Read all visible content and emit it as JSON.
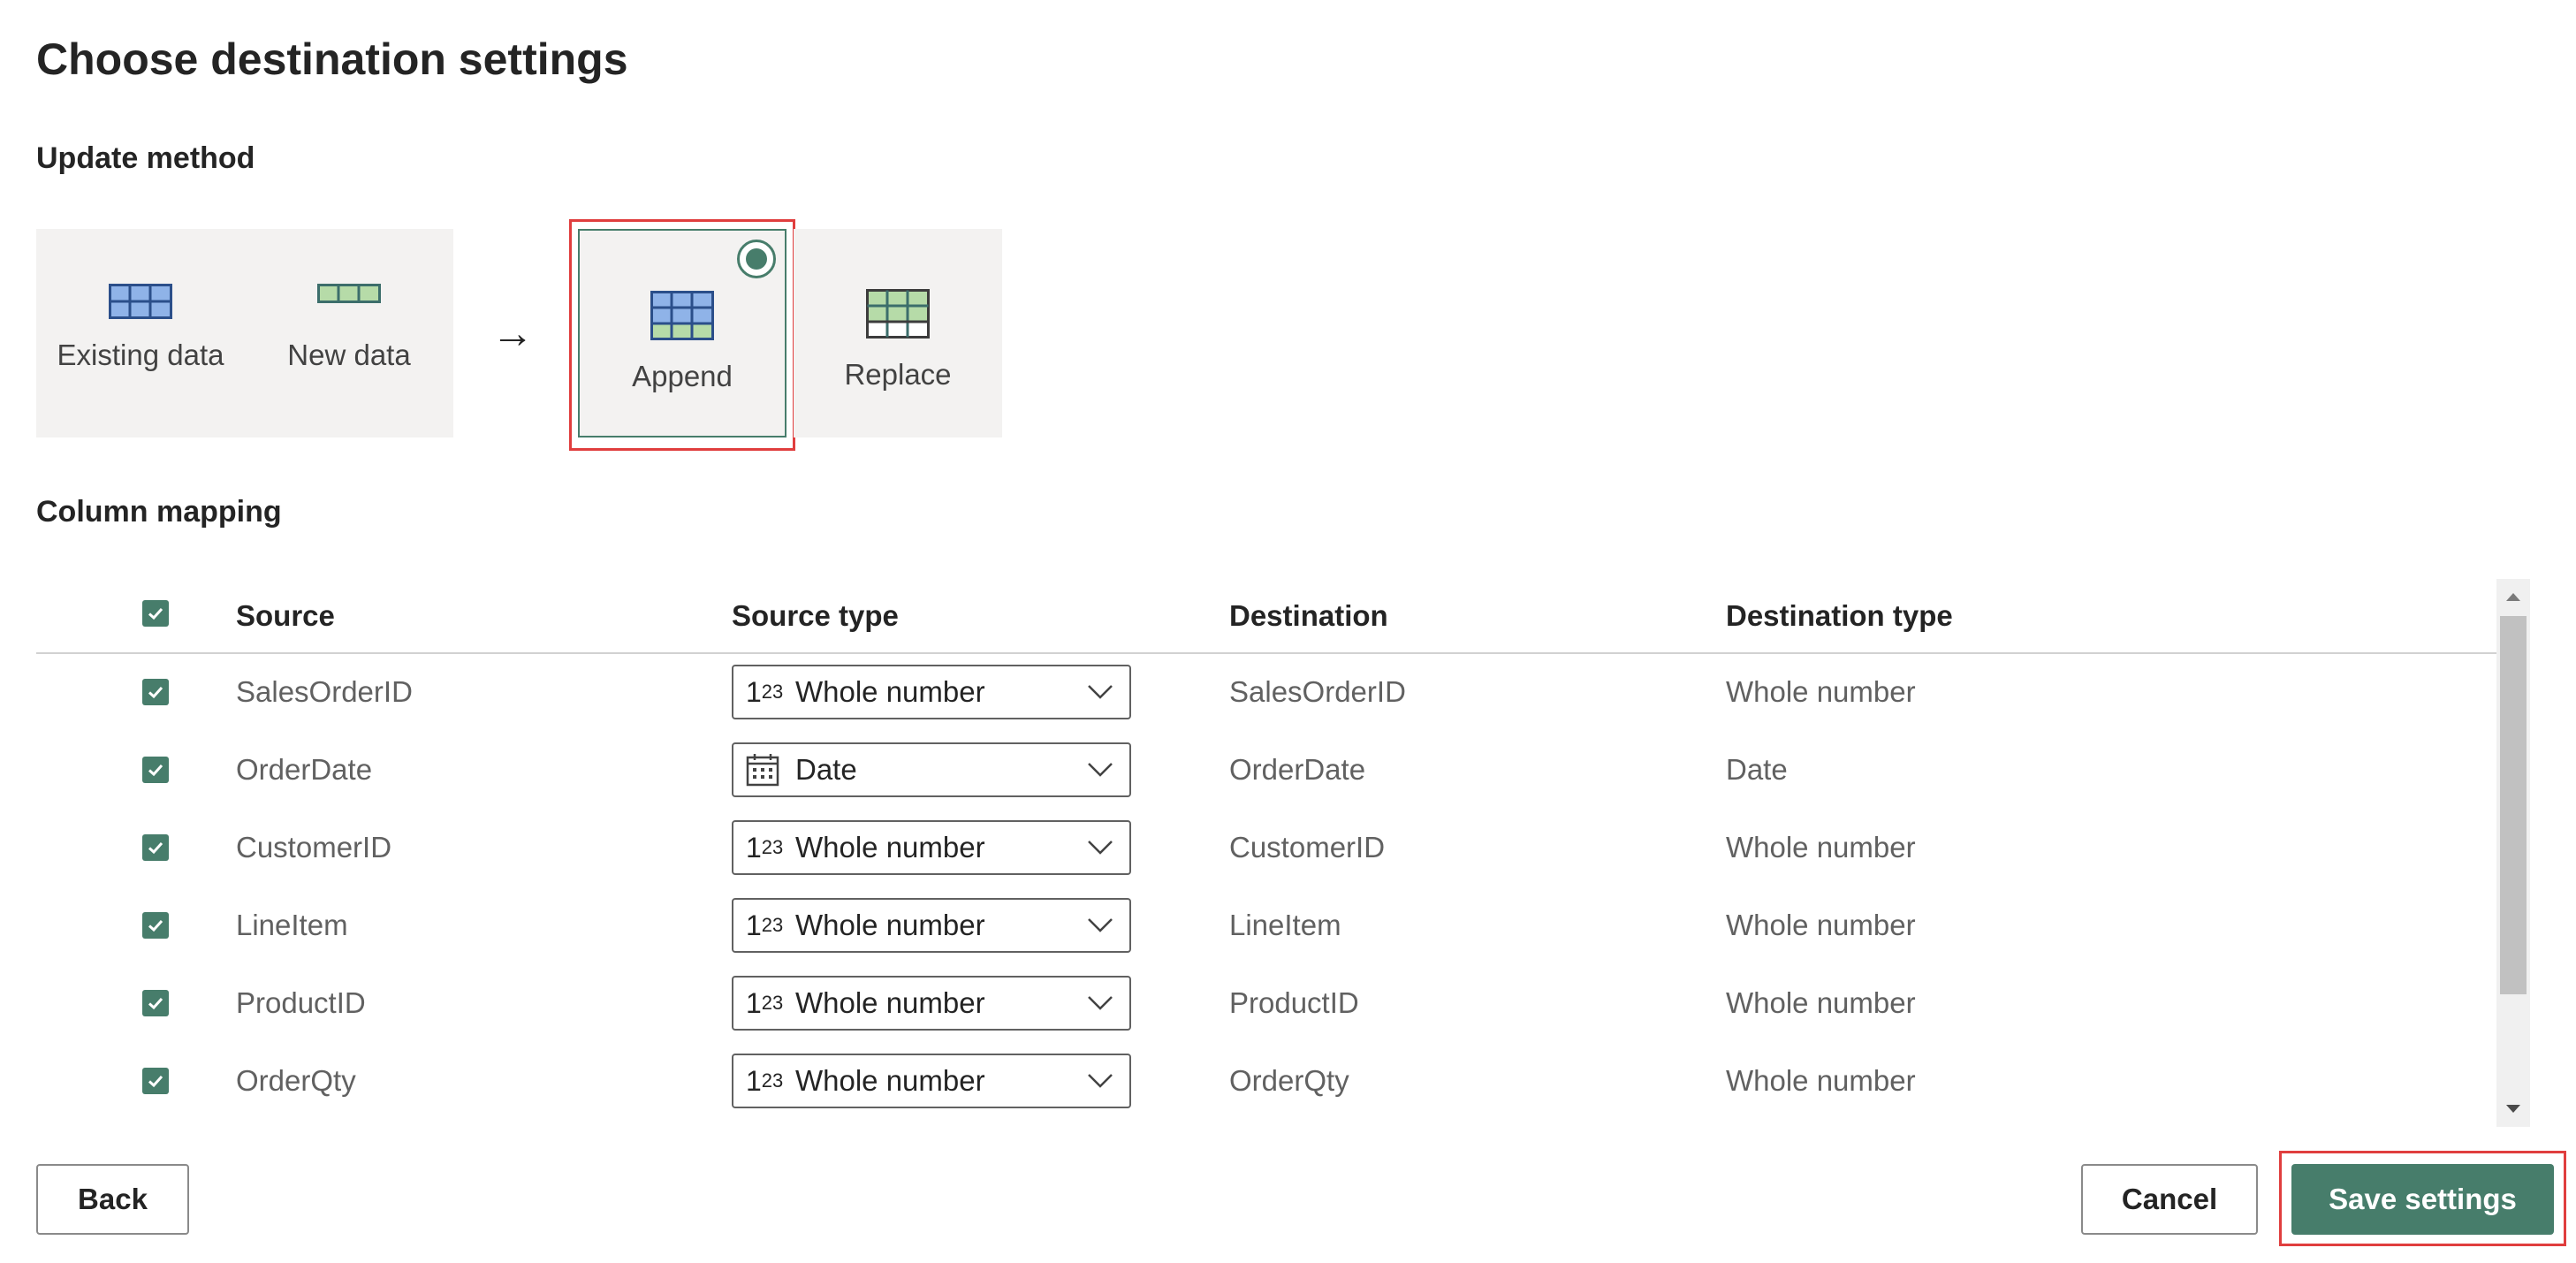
{
  "title": "Choose destination settings",
  "update_method": {
    "label": "Update method",
    "existing_data": "Existing data",
    "new_data": "New data",
    "arrow": "→",
    "options": [
      {
        "label": "Append",
        "selected": true
      },
      {
        "label": "Replace",
        "selected": false
      }
    ]
  },
  "column_mapping": {
    "label": "Column mapping",
    "headers": {
      "source": "Source",
      "source_type": "Source type",
      "destination": "Destination",
      "destination_type": "Destination type"
    },
    "rows": [
      {
        "checked": true,
        "source": "SalesOrderID",
        "source_type": "Whole number",
        "source_type_icon": "123",
        "destination": "SalesOrderID",
        "destination_type": "Whole number"
      },
      {
        "checked": true,
        "source": "OrderDate",
        "source_type": "Date",
        "source_type_icon": "calendar",
        "destination": "OrderDate",
        "destination_type": "Date"
      },
      {
        "checked": true,
        "source": "CustomerID",
        "source_type": "Whole number",
        "source_type_icon": "123",
        "destination": "CustomerID",
        "destination_type": "Whole number"
      },
      {
        "checked": true,
        "source": "LineItem",
        "source_type": "Whole number",
        "source_type_icon": "123",
        "destination": "LineItem",
        "destination_type": "Whole number"
      },
      {
        "checked": true,
        "source": "ProductID",
        "source_type": "Whole number",
        "source_type_icon": "123",
        "destination": "ProductID",
        "destination_type": "Whole number"
      },
      {
        "checked": true,
        "source": "OrderQty",
        "source_type": "Whole number",
        "source_type_icon": "123",
        "destination": "OrderQty",
        "destination_type": "Whole number"
      }
    ]
  },
  "footer": {
    "back": "Back",
    "cancel": "Cancel",
    "save": "Save settings"
  },
  "colors": {
    "accent": "#477d6b",
    "highlight": "#e03e3e",
    "panel_bg": "#f3f2f1"
  }
}
